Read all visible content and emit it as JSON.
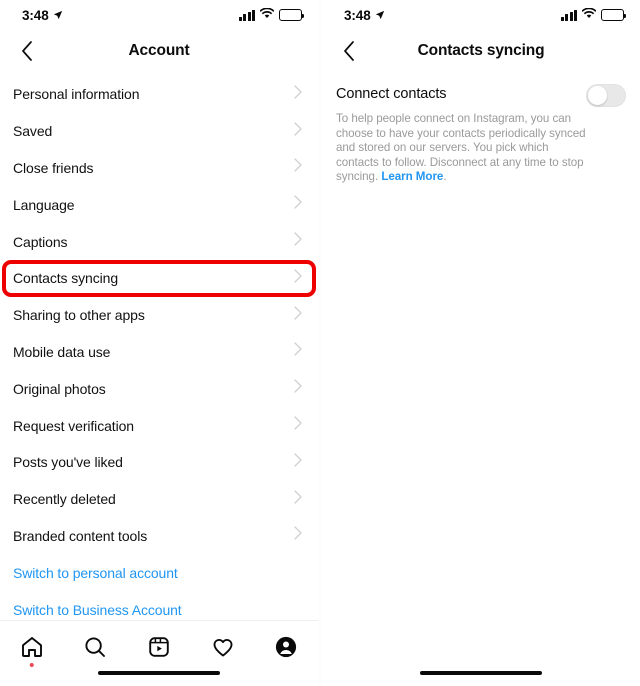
{
  "status_bar": {
    "time": "3:48",
    "location_icon": "location-arrow-icon",
    "signal_icon": "cellular-signal-icon",
    "wifi_icon": "wifi-icon",
    "battery_icon": "battery-icon"
  },
  "left_panel": {
    "header": {
      "back_icon": "chevron-left-icon",
      "title": "Account"
    },
    "rows": [
      {
        "label": "Personal information",
        "type": "nav"
      },
      {
        "label": "Saved",
        "type": "nav"
      },
      {
        "label": "Close friends",
        "type": "nav"
      },
      {
        "label": "Language",
        "type": "nav"
      },
      {
        "label": "Captions",
        "type": "nav"
      },
      {
        "label": "Contacts syncing",
        "type": "nav",
        "highlighted": true
      },
      {
        "label": "Sharing to other apps",
        "type": "nav"
      },
      {
        "label": "Mobile data use",
        "type": "nav"
      },
      {
        "label": "Original photos",
        "type": "nav"
      },
      {
        "label": "Request verification",
        "type": "nav"
      },
      {
        "label": "Posts you've liked",
        "type": "nav"
      },
      {
        "label": "Recently deleted",
        "type": "nav"
      },
      {
        "label": "Branded content tools",
        "type": "nav"
      },
      {
        "label": "Switch to personal account",
        "type": "link"
      },
      {
        "label": "Switch to Business Account",
        "type": "link"
      }
    ],
    "tabbar": [
      {
        "name": "home-icon",
        "badge": true
      },
      {
        "name": "search-icon",
        "badge": false
      },
      {
        "name": "reels-icon",
        "badge": false
      },
      {
        "name": "heart-icon",
        "badge": false
      },
      {
        "name": "profile-icon",
        "badge": false
      }
    ]
  },
  "right_panel": {
    "header": {
      "back_icon": "chevron-left-icon",
      "title": "Contacts syncing"
    },
    "connect_contacts": {
      "title": "Connect contacts",
      "toggle_state": "off",
      "description": "To help people connect on Instagram, you can choose to have your contacts periodically synced and stored on our servers. You pick which contacts to follow. Disconnect at any time to stop syncing. ",
      "learn_more": "Learn More",
      "description_end": "."
    }
  },
  "colors": {
    "highlight_red": "#ef0000",
    "link_blue": "#2196f3",
    "badge_red": "#ed4956",
    "muted_text": "#9a9a9a"
  }
}
